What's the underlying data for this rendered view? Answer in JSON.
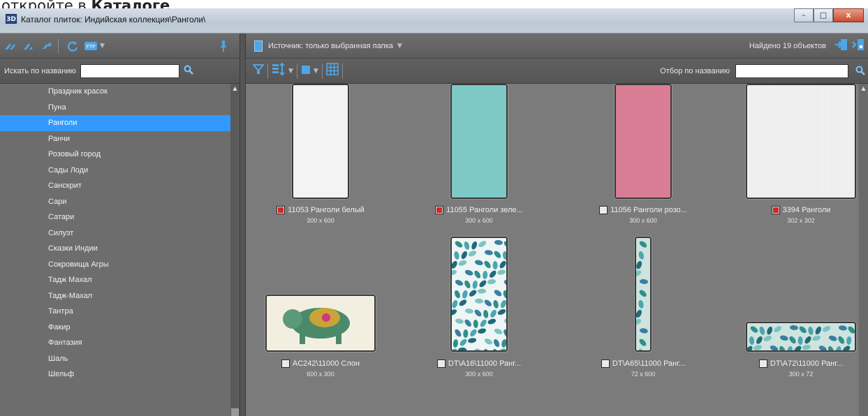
{
  "page_header": {
    "prefix": "откройте в ",
    "bold": "Каталоге"
  },
  "window": {
    "icon_label": "3D",
    "title": "Каталог плиток: Индийская коллекция\\Ранголи\\",
    "controls": {
      "minimize": "–",
      "maximize": "□",
      "close": "x"
    }
  },
  "left_pane": {
    "search_label": "Искать по названию",
    "search_value": "",
    "tree_items": [
      "Праздник красок",
      "Пуна",
      "Ранголи",
      "Ранчи",
      "Розовый город",
      "Сады Лоди",
      "Санскрит",
      "Сари",
      "Сатари",
      "Силуэт",
      "Сказки Индии",
      "Сокровища Агры",
      "Тадж Махал",
      "Тадж-Махал",
      "Тантра",
      "Факир",
      "Фантазия",
      "Шаль",
      "Шельф"
    ],
    "selected_item": "Ранголи"
  },
  "right_pane": {
    "source_label": "Источник: только выбранная папка",
    "found_label": "Найдено 19 объектов",
    "filter_label": "Отбор по названию",
    "filter_value": ""
  },
  "tiles": [
    {
      "name": "11053 Ранголи белый",
      "dims": "300 x 600",
      "checked": true,
      "color": "#f3f3f3",
      "pattern": "plain"
    },
    {
      "name": "11055 Ранголи зеле...",
      "dims": "300 x 600",
      "checked": true,
      "color": "#7ec8c6",
      "pattern": "plain"
    },
    {
      "name": "11056 Ранголи розо...",
      "dims": "300 x 600",
      "checked": false,
      "color": "#d97d95",
      "pattern": "plain"
    },
    {
      "name": "3394 Ранголи",
      "dims": "302 x 302",
      "checked": true,
      "color": "#f5f5f5",
      "pattern": "lines"
    },
    {
      "name": "AC242\\11000 Слон",
      "dims": "600 x 300",
      "checked": false,
      "color": "#f3efe0",
      "pattern": "elephant"
    },
    {
      "name": "DT\\A16\\11000 Ранг...",
      "dims": "300 x 600",
      "checked": false,
      "color": "#eef5f5",
      "pattern": "paisley"
    },
    {
      "name": "DT\\A65\\11000 Ранг...",
      "dims": "72 x 600",
      "checked": false,
      "color": "#cfe3df",
      "pattern": "strip"
    },
    {
      "name": "DT\\A72\\11000 Ранг...",
      "dims": "300 x 72",
      "checked": false,
      "color": "#cfe3df",
      "pattern": "strip"
    }
  ]
}
